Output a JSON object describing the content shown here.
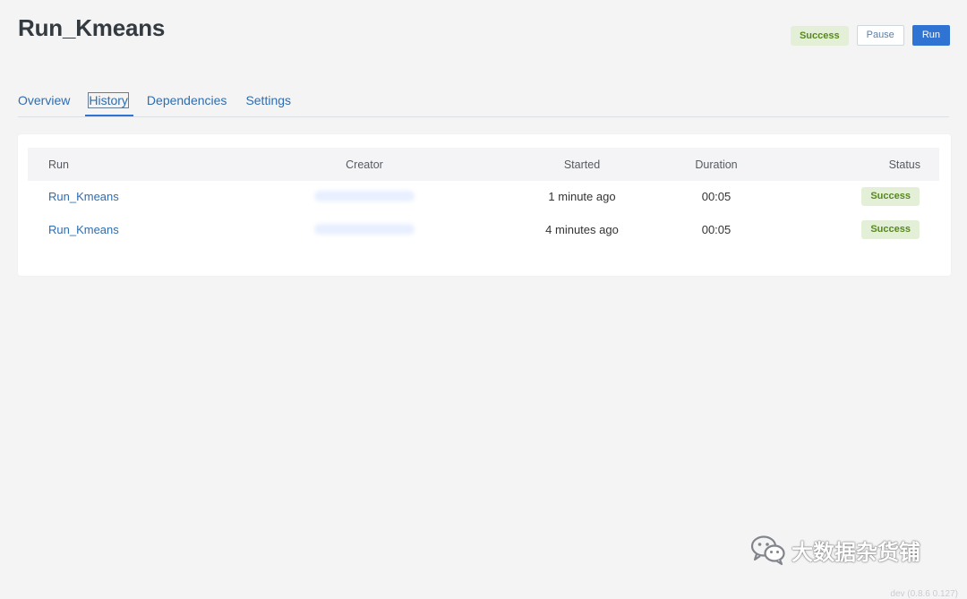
{
  "page": {
    "title": "Run_Kmeans"
  },
  "header": {
    "status": "Success",
    "pause_label": "Pause",
    "run_label": "Run"
  },
  "tabs": [
    {
      "label": "Overview",
      "active": false
    },
    {
      "label": "History",
      "active": true
    },
    {
      "label": "Dependencies",
      "active": false
    },
    {
      "label": "Settings",
      "active": false
    }
  ],
  "history_table": {
    "columns": {
      "run": "Run",
      "creator": "Creator",
      "started": "Started",
      "duration": "Duration",
      "status": "Status"
    },
    "rows": [
      {
        "run": "Run_Kmeans",
        "started": "1 minute ago",
        "duration": "00:05",
        "status": "Success"
      },
      {
        "run": "Run_Kmeans",
        "started": "4 minutes ago",
        "duration": "00:05",
        "status": "Success"
      }
    ]
  },
  "watermark": {
    "text": "大数据杂货铺"
  },
  "footer": {
    "version": "dev (0.8.6 0.127)"
  },
  "colors": {
    "accent": "#2f74d2",
    "link": "#2e6db0",
    "success_bg": "#e3efd6",
    "success_text": "#57881f",
    "background": "#f4f4f5"
  },
  "icons": {
    "watermark_logo": "wechat-logo-icon"
  }
}
